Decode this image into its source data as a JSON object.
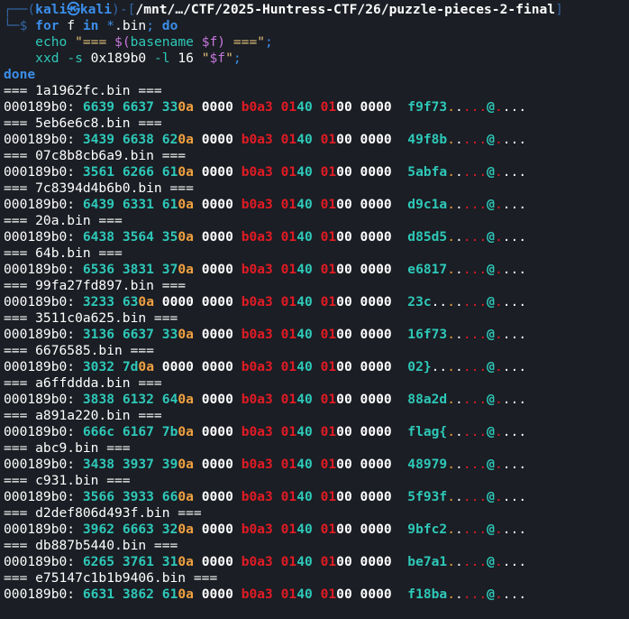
{
  "prompt": {
    "box_top": "┌──(",
    "user": "kali㉿kali",
    "mid": ")-[",
    "path": "/mnt/…/CTF/2025-Huntress-CTF/26/puzzle-pieces-2-final",
    "end": "]",
    "box_bottom": "└─$ "
  },
  "command": {
    "line1": {
      "kw_for": "for",
      "text1": " f ",
      "kw_in": "in",
      "text2": " ",
      "glob_star": "*",
      "glob_rest": ".bin",
      "semi": ";",
      "text3": " ",
      "kw_do": "do"
    },
    "line2": {
      "indent": "    ",
      "cmd": "echo",
      "sp": " ",
      "str_start": "\"=== ",
      "subst": "$(",
      "inner_cmd": "basename",
      "inner_sp": " ",
      "var": "$f",
      "subst_end": ")",
      "str_end": " ===\"",
      "semi": ";"
    },
    "line3": {
      "indent": "    ",
      "cmd": "xxd",
      "sp1": " ",
      "opt1": "-s",
      "sp2": " 0x189b0 ",
      "opt2": "-l",
      "sp3": " 16 ",
      "str_q1": "\"",
      "var": "$f",
      "str_q2": "\"",
      "semi": ";"
    },
    "done": "done"
  },
  "dump_common": {
    "addr": "000189b0: ",
    "zero": "0000",
    "b0a3": "b0a3",
    "g01": "01",
    "g40": "40",
    "g0100_a": "01",
    "g0100_b": "00",
    "sep2": "  ",
    "dots_red": "...",
    "at": "@",
    "dots_tail": "...",
    "dot": "."
  },
  "files": [
    {
      "name": "1a1962fc.bin",
      "g1": "6639",
      "g2": "6637",
      "g3a": "33",
      "g3b": "0a",
      "ascii": "f9f73",
      "pad": ""
    },
    {
      "name": "5eb6e6c8.bin",
      "g1": "3439",
      "g2": "6638",
      "g3a": "62",
      "g3b": "0a",
      "ascii": "49f8b",
      "pad": ""
    },
    {
      "name": "07c8b8cb6a9.bin",
      "g1": "3561",
      "g2": "6266",
      "g3a": "61",
      "g3b": "0a",
      "ascii": "5abfa",
      "pad": ""
    },
    {
      "name": "7c8394d4b6b0.bin",
      "g1": "6439",
      "g2": "6331",
      "g3a": "61",
      "g3b": "0a",
      "ascii": "d9c1a",
      "pad": ""
    },
    {
      "name": "20a.bin",
      "g1": "6438",
      "g2": "3564",
      "g3a": "35",
      "g3b": "0a",
      "ascii": "d85d5",
      "pad": ""
    },
    {
      "name": "64b.bin",
      "g1": "6536",
      "g2": "3831",
      "g3a": "37",
      "g3b": "0a",
      "ascii": "e6817",
      "pad": ""
    },
    {
      "name": "99fa27fd897.bin",
      "g1": "3233",
      "g2": "63",
      "g2b": "0a",
      "g3a": "",
      "g3b": "",
      "g3full": "0000",
      "ascii": "23c",
      "pad": ".."
    },
    {
      "name": "3511c0a625.bin",
      "g1": "3136",
      "g2": "6637",
      "g3a": "33",
      "g3b": "0a",
      "ascii": "16f73",
      "pad": ""
    },
    {
      "name": "6676585.bin",
      "g1": "3032",
      "g2": "7d",
      "g2b": "0a",
      "g3a": "",
      "g3b": "",
      "g3full": "0000",
      "ascii": "02}",
      "pad": ".."
    },
    {
      "name": "a6ffddda.bin",
      "g1": "3838",
      "g2": "6132",
      "g3a": "64",
      "g3b": "0a",
      "ascii": "88a2d",
      "pad": ""
    },
    {
      "name": "a891a220.bin",
      "g1": "666c",
      "g2": "6167",
      "g3a": "7b",
      "g3b": "0a",
      "ascii": "flag{",
      "pad": ""
    },
    {
      "name": "abc9.bin",
      "g1": "3438",
      "g2": "3937",
      "g3a": "39",
      "g3b": "0a",
      "ascii": "48979",
      "pad": ""
    },
    {
      "name": "c931.bin",
      "g1": "3566",
      "g2": "3933",
      "g3a": "66",
      "g3b": "0a",
      "ascii": "5f93f",
      "pad": ""
    },
    {
      "name": "d2def806d493f.bin",
      "g1": "3962",
      "g2": "6663",
      "g3a": "32",
      "g3b": "0a",
      "ascii": "9bfc2",
      "pad": ""
    },
    {
      "name": "db887b5440.bin",
      "g1": "6265",
      "g2": "3761",
      "g3a": "31",
      "g3b": "0a",
      "ascii": "be7a1",
      "pad": ""
    },
    {
      "name": "e75147c1b1b9406.bin",
      "g1": "6631",
      "g2": "3862",
      "g3a": "61",
      "g3b": "0a",
      "ascii": "f18ba",
      "pad": ""
    }
  ],
  "colors": {
    "background": "#1b1e24",
    "prompt_blue": "#3b8eea",
    "hex_teal": "#2ec8b9",
    "newline_orange": "#f0a040",
    "nonprint_red": "#e01b24",
    "string_yellow": "#e5c07b"
  }
}
